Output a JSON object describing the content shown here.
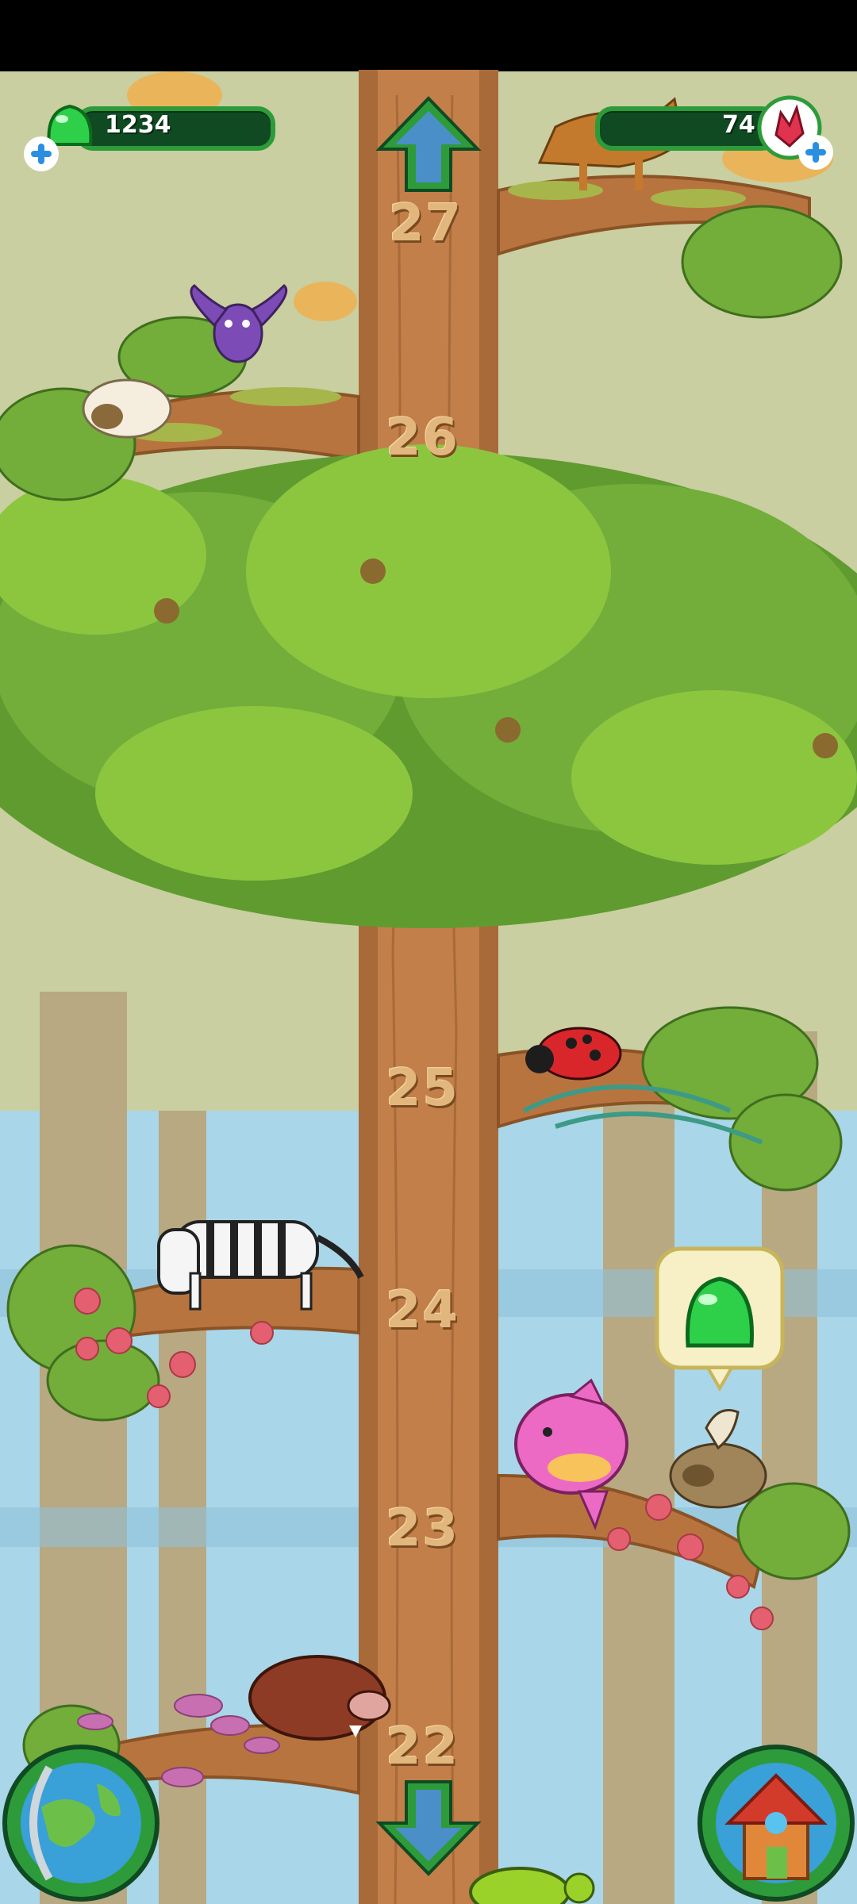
{
  "hud": {
    "jelly_count": "1234",
    "gem_count": "74",
    "jelly_icon": "green-jelly-icon",
    "gem_icon": "red-crystal-icon",
    "add_icon": "plus-icon"
  },
  "floors": [
    "27",
    "26",
    "25",
    "24",
    "23",
    "22"
  ],
  "navigation": {
    "up_icon": "arrow-up-icon",
    "down_icon": "arrow-down-icon",
    "globe_icon": "globe-icon",
    "home_icon": "house-icon"
  },
  "animals": [
    "fox",
    "bat",
    "sleeping-sheep",
    "ladybug",
    "zebra",
    "sunfish",
    "griffin",
    "boar",
    "turtle"
  ],
  "reward_bubble_icon": "green-jelly-icon",
  "colors": {
    "trunk": "#c27f4a",
    "leaf_light": "#8cc63f",
    "leaf_dark": "#5f9b2f",
    "sky": "#9fd3e6",
    "hud_green": "#2e9b3a",
    "hud_bar": "#0f4a22"
  }
}
